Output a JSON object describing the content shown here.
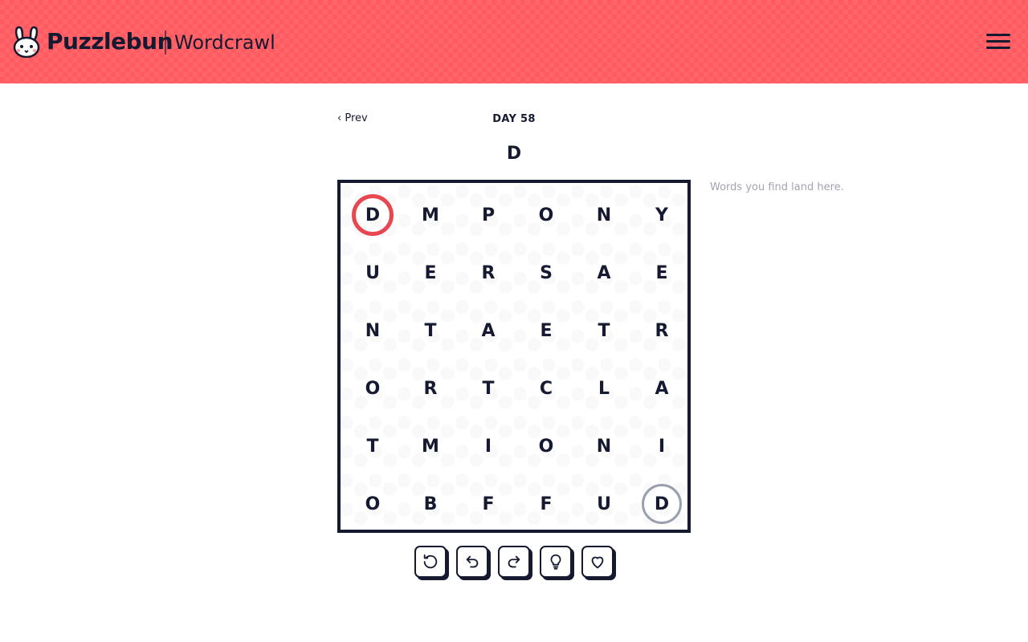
{
  "header": {
    "brand": "Puzzlebun",
    "product": "Wordcrawl",
    "logo_icon": "bunny-logo-icon",
    "menu_icon": "hamburger-menu-icon",
    "background_color": "#ff5a60"
  },
  "nav": {
    "prev_label": "‹ Prev",
    "day_label": "DAY 58"
  },
  "current_word": "D",
  "grid": {
    "rows": [
      [
        "D",
        "M",
        "P",
        "O",
        "N",
        "Y"
      ],
      [
        "U",
        "E",
        "R",
        "S",
        "A",
        "E"
      ],
      [
        "N",
        "T",
        "A",
        "E",
        "T",
        "R"
      ],
      [
        "O",
        "R",
        "T",
        "C",
        "L",
        "A"
      ],
      [
        "T",
        "M",
        "I",
        "O",
        "N",
        "I"
      ],
      [
        "O",
        "B",
        "F",
        "F",
        "U",
        "D"
      ]
    ],
    "start_cell": [
      0,
      0
    ],
    "end_cell": [
      5,
      5
    ],
    "start_color": "#e9474f",
    "end_color": "#9a9fad"
  },
  "found_words_placeholder": "Words you find land here.",
  "toolbar": {
    "buttons": [
      {
        "name": "reset-button",
        "icon": "reset-icon"
      },
      {
        "name": "undo-button",
        "icon": "undo-icon"
      },
      {
        "name": "redo-button",
        "icon": "redo-icon"
      },
      {
        "name": "hint-button",
        "icon": "lightbulb-icon"
      },
      {
        "name": "favorite-button",
        "icon": "heart-icon"
      }
    ]
  }
}
